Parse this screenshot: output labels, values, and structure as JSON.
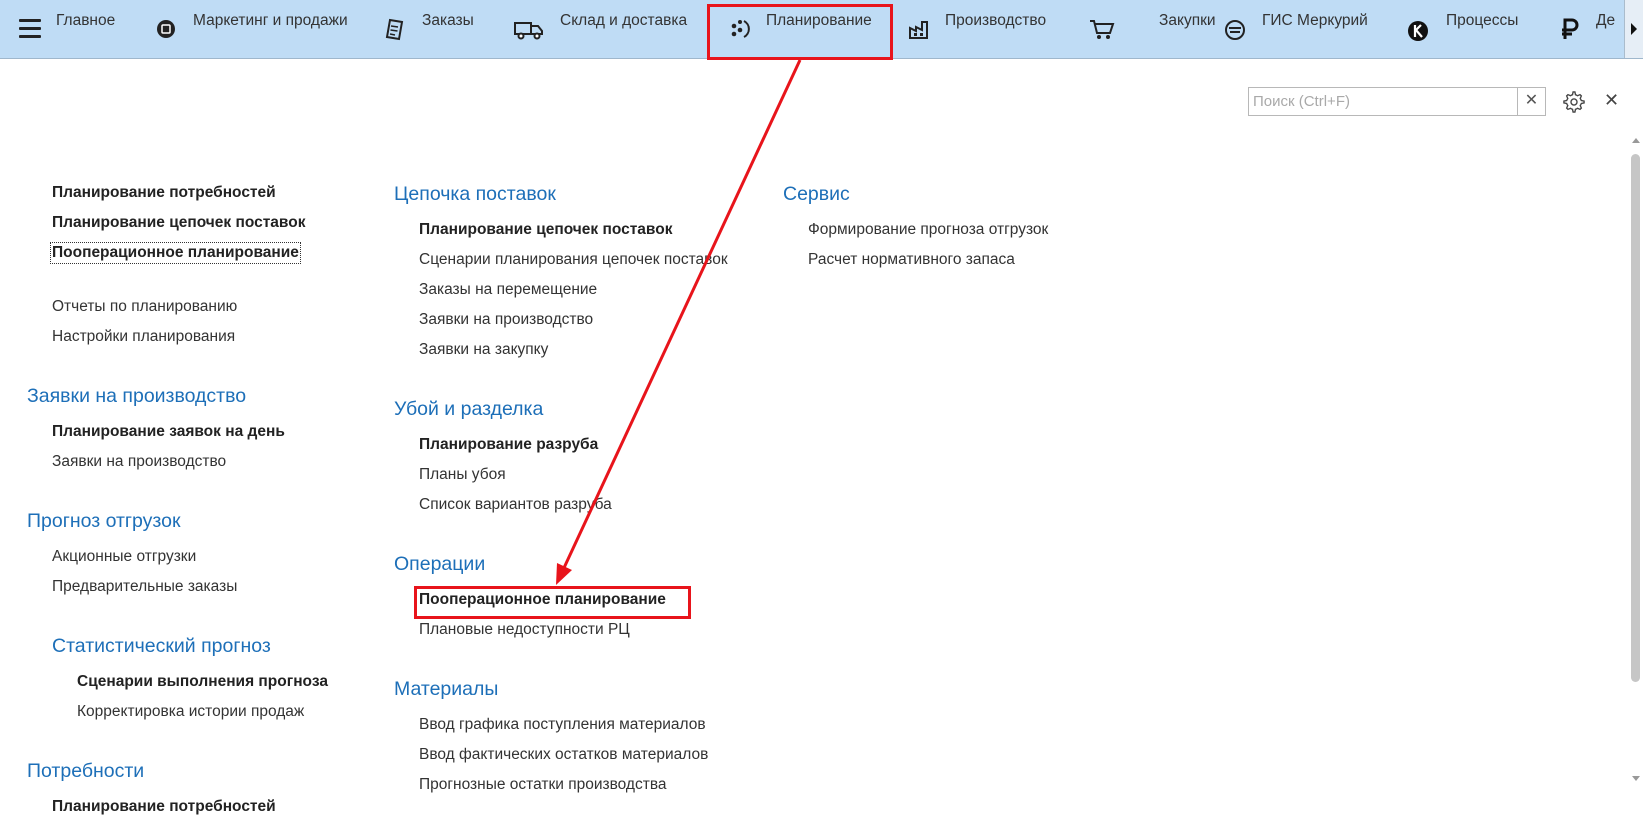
{
  "nav": {
    "items": [
      {
        "label": "Главное",
        "icon": "menu-icon"
      },
      {
        "label": "Маркетинг и продажи",
        "icon": "marketing-icon"
      },
      {
        "label": "Заказы",
        "icon": "orders-icon"
      },
      {
        "label": "Склад и доставка",
        "icon": "truck-icon"
      },
      {
        "label": "Планирование",
        "icon": "planning-icon"
      },
      {
        "label": "Производство",
        "icon": "factory-icon"
      },
      {
        "label": "Закупки",
        "icon": "cart-icon"
      },
      {
        "label": "ГИС Меркурий",
        "icon": "mercury-icon"
      },
      {
        "label": "Процессы",
        "icon": "processes-icon"
      },
      {
        "label": "Де",
        "icon": "ruble-icon"
      }
    ],
    "active": "Планирование"
  },
  "search": {
    "placeholder": "Поиск (Ctrl+F)",
    "value": ""
  },
  "col1": {
    "top": [
      "Планирование потребностей",
      "Планирование цепочек поставок",
      "Пооперационное планирование"
    ],
    "top2": [
      "Отчеты по планированию",
      "Настройки планирования"
    ],
    "s1": {
      "title": "Заявки на производство",
      "items": [
        "Планирование заявок на день",
        "Заявки на производство"
      ]
    },
    "s2": {
      "title": "Прогноз отгрузок",
      "items": [
        "Акционные отгрузки",
        "Предварительные заказы"
      ]
    },
    "s3": {
      "title": "Статистический прогноз",
      "items": [
        "Сценарии выполнения прогноза",
        "Корректировка истории продаж"
      ]
    },
    "s4": {
      "title": "Потребности",
      "items": [
        "Планирование потребностей"
      ]
    }
  },
  "col2": {
    "s1": {
      "title": "Цепочка поставок",
      "items": [
        "Планирование цепочек поставок",
        "Сценарии планирования цепочек поставок",
        "Заказы на перемещение",
        "Заявки на производство",
        "Заявки на закупку"
      ]
    },
    "s2": {
      "title": "Убой и разделка",
      "items": [
        "Планирование разруба",
        "Планы убоя",
        "Список вариантов разруба"
      ]
    },
    "s3": {
      "title": "Операции",
      "items": [
        "Пооперационное планирование",
        "Плановые недоступности РЦ"
      ]
    },
    "s4": {
      "title": "Материалы",
      "items": [
        "Ввод графика поступления материалов",
        "Ввод фактических остатков материалов",
        "Прогнозные остатки производства"
      ]
    }
  },
  "col3": {
    "s1": {
      "title": "Сервис",
      "items": [
        "Формирование прогноза отгрузок",
        "Расчет нормативного запаса"
      ]
    }
  },
  "colors": {
    "accent": "#1d6fb8",
    "highlight": "#e8141b",
    "topbar": "#bfdcf5"
  }
}
